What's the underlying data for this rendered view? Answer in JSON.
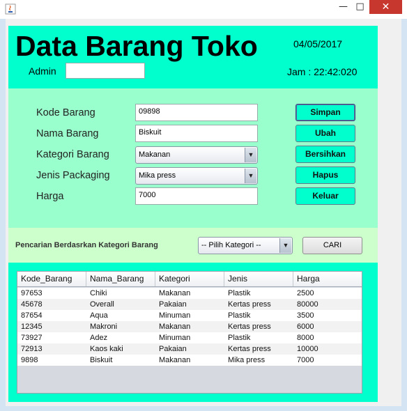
{
  "window": {
    "minimize_glyph": "—",
    "maximize_glyph": "□",
    "close_glyph": "✕"
  },
  "header": {
    "title": "Data Barang Toko",
    "date": "04/05/2017",
    "admin_label": "Admin",
    "admin_value": "",
    "jam": "Jam : 22:42:020"
  },
  "form": {
    "kode_label": "Kode Barang",
    "kode_value": "09898",
    "nama_label": "Nama Barang",
    "nama_value": "Biskuit",
    "kategori_label": "Kategori Barang",
    "kategori_value": "Makanan",
    "jenis_label": "Jenis Packaging",
    "jenis_value": "Mika press",
    "harga_label": "Harga",
    "harga_value": "7000"
  },
  "buttons": {
    "simpan": "Simpan",
    "ubah": "Ubah",
    "bersihkan": "Bersihkan",
    "hapus": "Hapus",
    "keluar": "Keluar"
  },
  "search": {
    "label": "Pencarian Berdasrkan Kategori Barang",
    "select_value": "-- Pilih Kategori --",
    "button": "CARI"
  },
  "table": {
    "columns": [
      "Kode_Barang",
      "Nama_Barang",
      "Kategori",
      "Jenis",
      "Harga"
    ],
    "rows": [
      [
        "97653",
        "Chiki",
        "Makanan",
        "Plastik",
        "2500"
      ],
      [
        "45678",
        "Overall",
        "Pakaian",
        "Kertas press",
        "80000"
      ],
      [
        "87654",
        "Aqua",
        "Minuman",
        "Plastik",
        "3500"
      ],
      [
        "12345",
        "Makroni",
        "Makanan",
        "Kertas press",
        "6000"
      ],
      [
        "73927",
        "Adez",
        "Minuman",
        "Plastik",
        "8000"
      ],
      [
        "72913",
        "Kaos kaki",
        "Pakaian",
        "Kertas press",
        "10000"
      ],
      [
        "9898",
        "Biskuit",
        "Makanan",
        "Mika press",
        "7000"
      ]
    ]
  },
  "colors": {
    "header_bg": "#00ffcc",
    "form_bg": "#99ffcc",
    "search_bg": "#ccffcc",
    "button_bg": "#00ffcc"
  }
}
